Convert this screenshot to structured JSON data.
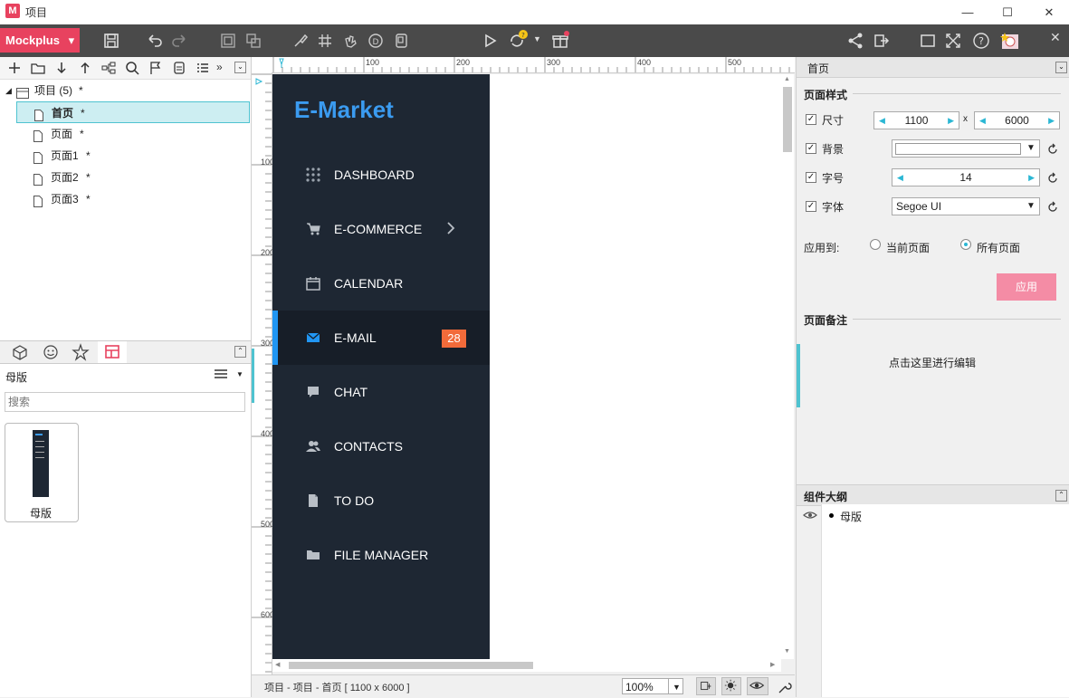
{
  "window": {
    "title": "项目",
    "logo_letter": "M",
    "minimize": "—",
    "maximize": "☐",
    "close": "✕"
  },
  "toolbar": {
    "brand": "Mockplus",
    "brand_arrow": "▾",
    "close": "✕"
  },
  "project_tree": {
    "root": {
      "label": "项目 (5)",
      "mark": "*"
    },
    "pages": [
      {
        "label": "首页",
        "mark": "*",
        "selected": true
      },
      {
        "label": "页面",
        "mark": "*"
      },
      {
        "label": "页面1",
        "mark": "*"
      },
      {
        "label": "页面2",
        "mark": "*"
      },
      {
        "label": "页面3",
        "mark": "*"
      }
    ]
  },
  "library": {
    "section_label": "母版",
    "search_placeholder": "搜索",
    "master_items": [
      {
        "label": "母版"
      }
    ]
  },
  "ruler": {
    "top": [
      "100",
      "200",
      "300",
      "400",
      "500"
    ],
    "left": [
      "100",
      "200",
      "300",
      "400",
      "500",
      "600"
    ]
  },
  "canvas_page": {
    "logo": "E-Market",
    "nav": [
      {
        "label": "DASHBOARD",
        "icon": "grid-icon"
      },
      {
        "label": "E-COMMERCE",
        "icon": "cart-icon",
        "has_chevron": true
      },
      {
        "label": "CALENDAR",
        "icon": "calendar-icon"
      },
      {
        "label": "E-MAIL",
        "icon": "mail-icon",
        "active": true,
        "badge": "28"
      },
      {
        "label": "CHAT",
        "icon": "chat-icon"
      },
      {
        "label": "CONTACTS",
        "icon": "contacts-icon"
      },
      {
        "label": "TO DO",
        "icon": "document-icon"
      },
      {
        "label": "FILE MANAGER",
        "icon": "folder-icon"
      }
    ],
    "colors": {
      "sidebar": "#1e2733",
      "accent": "#3b9bf0",
      "active_bar": "#2196f3",
      "badge": "#f26b3a"
    }
  },
  "statusbar": {
    "path": "项目 - 项目 - 首页 [ 1100 x 6000 ]",
    "zoom": "100%"
  },
  "properties": {
    "header": "首页",
    "page_style_title": "页面样式",
    "size": {
      "label": "尺寸",
      "width": "1100",
      "times": "x",
      "height": "6000"
    },
    "background": {
      "label": "背景"
    },
    "font_size": {
      "label": "字号",
      "value": "14"
    },
    "font": {
      "label": "字体",
      "value": "Segoe UI"
    },
    "apply_to": {
      "label": "应用到:",
      "options": [
        "当前页面",
        "所有页面"
      ],
      "selected": "所有页面"
    },
    "apply_button": "应用",
    "notes_title": "页面备注",
    "notes_placeholder": "点击这里进行编辑"
  },
  "outline": {
    "title": "组件大纲",
    "items": [
      {
        "label": "母版"
      }
    ]
  }
}
